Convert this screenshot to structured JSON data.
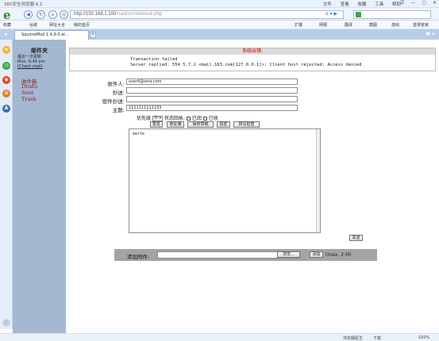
{
  "window": {
    "title": "360安全浏览器 6.1",
    "menu": [
      "文件",
      "查看",
      "收藏",
      "工具",
      "帮助"
    ],
    "controls": [
      "☰",
      "—",
      "▢",
      "✕"
    ]
  },
  "address": {
    "host": "http://192.168.1.100",
    "path": "/mail/src/webmail.php",
    "search_value": ""
  },
  "favorites": {
    "left": [
      "收藏",
      "谷歌",
      "网址大全",
      "我的首页"
    ],
    "right": [
      "扩展",
      "网银",
      "翻译",
      "截图",
      "游戏",
      "登录管家"
    ]
  },
  "tabs": {
    "active_label": "SquirrelMail 1.4.8-5.el...",
    "new_tab": "+"
  },
  "folders": {
    "heading": "邮件夹",
    "last_refresh_label": "最近一次更新:",
    "last_refresh_time": "Mon, 6:44 pm",
    "check_mail": "(Check mail)",
    "items": [
      "收件箱",
      "Drafts",
      "Sent",
      "Trash"
    ]
  },
  "error": {
    "title": "系统出错:",
    "line1": "Transaction failed",
    "line2": "Server replied: 554 5.7.1 <mail.163.com[127.0.0.1]>: Client host rejected: Access denied"
  },
  "form": {
    "to_label": "收件人:",
    "to_value": "user4@sina.com",
    "cc_label": "抄送:",
    "cc_value": "",
    "bcc_label": "密件抄送:",
    "bcc_value": "",
    "subject_label": "主题:",
    "subject_value": "1111111111133",
    "priority_label": "优先级",
    "priority_value": "中",
    "receipt_label": "状态回执:",
    "read_label": "已阅",
    "delivered_label": "已收",
    "buttons": [
      "签名",
      "地址簿",
      "保存草稿",
      "加密",
      "拼写检查"
    ],
    "body_value": "eerte",
    "send_label": "发送"
  },
  "attach": {
    "label": "添加附件:",
    "browse_label": "浏览...",
    "add_label": "添加",
    "size_note": "(max. 2 M)"
  },
  "status": {
    "left": "",
    "right": [
      "浏览器医生",
      "下载",
      "100%"
    ]
  }
}
